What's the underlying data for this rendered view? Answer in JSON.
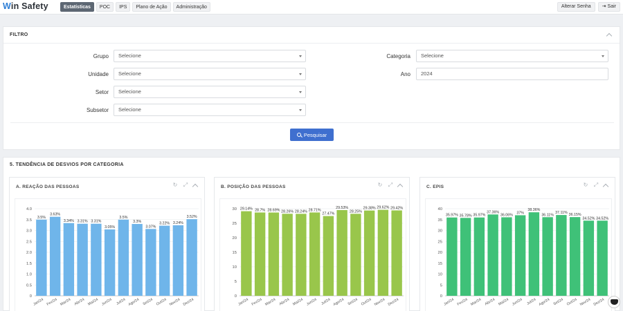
{
  "brand": {
    "name": "Win Safety",
    "mark": "W"
  },
  "nav": [
    "Estatísticas",
    "POC",
    "IPS",
    "Plano de Ação",
    "Administração"
  ],
  "top_right": {
    "change_password": "Alterar Senha",
    "logout": "Sair"
  },
  "filter": {
    "title": "FILTRO",
    "fields": {
      "grupo": {
        "label": "Grupo",
        "value": "Selecione"
      },
      "unidade": {
        "label": "Unidade",
        "value": "Selecione"
      },
      "setor": {
        "label": "Setor",
        "value": "Selecione"
      },
      "subsetor": {
        "label": "Subsetor",
        "value": "Selecione"
      },
      "categoria": {
        "label": "Categoria",
        "value": "Selecione"
      },
      "ano": {
        "label": "Ano",
        "value": "2024"
      }
    },
    "search_button": "Pesquisar"
  },
  "section": {
    "title": "5. TENDÊNCIA DE DESVIOS POR CATEGORIA"
  },
  "chart_data": [
    {
      "type": "bar",
      "title": "A. REAÇÃO DAS PESSOAS",
      "color": "#6fb5ea",
      "categories": [
        "Jan/24",
        "Fev/24",
        "Mar/24",
        "Abr/24",
        "Mai/24",
        "Jun/24",
        "Jul/24",
        "Ago/24",
        "Set/24",
        "Out/24",
        "Nov/24",
        "Dez/24"
      ],
      "values": [
        3.5,
        3.63,
        3.34,
        3.31,
        3.31,
        3.05,
        3.5,
        3.3,
        3.07,
        3.22,
        3.24,
        3.52
      ],
      "labels": [
        "3.5%",
        "3.63%",
        "3.34%",
        "3.31%",
        "3.31%",
        "3.05%",
        "3.5%",
        "3.3%",
        "3.07%",
        "3.22%",
        "3.24%",
        "3.52%"
      ],
      "yticks": [
        "0",
        "0.5",
        "1.0",
        "1.5",
        "2.0",
        "2.5",
        "3.0",
        "3.5",
        "4.0"
      ],
      "ylim": [
        0,
        4.0
      ]
    },
    {
      "type": "bar",
      "title": "B. POSIÇÃO DAS PESSOAS",
      "color": "#99c64b",
      "categories": [
        "Jan/24",
        "Fev/24",
        "Mar/24",
        "Abr/24",
        "Mai/24",
        "Jun/24",
        "Jul/24",
        "Ago/24",
        "Set/24",
        "Out/24",
        "Nov/24",
        "Dez/24"
      ],
      "values": [
        29.14,
        28.7,
        28.69,
        28.26,
        28.24,
        28.71,
        27.47,
        29.53,
        28.25,
        29.38,
        29.62,
        29.42
      ],
      "labels": [
        "29.14%",
        "28.7%",
        "28.69%",
        "28.26%",
        "28.24%",
        "28.71%",
        "27.47%",
        "29.53%",
        "28.25%",
        "29.38%",
        "29.62%",
        "29.42%"
      ],
      "yticks": [
        "0",
        "5",
        "10",
        "15",
        "20",
        "25",
        "30"
      ],
      "ylim": [
        0,
        30
      ]
    },
    {
      "type": "bar",
      "title": "C. EPIS",
      "color": "#3fc178",
      "categories": [
        "Jan/24",
        "Fev/24",
        "Mar/24",
        "Abr/24",
        "Mai/24",
        "Jun/24",
        "Jul/24",
        "Ago/24",
        "Set/24",
        "Out/24",
        "Nov/24",
        "Dez/24"
      ],
      "values": [
        35.97,
        35.78,
        35.97,
        37.36,
        36.06,
        37,
        38.36,
        36.11,
        37.11,
        36.15,
        34.52,
        34.52
      ],
      "labels": [
        "35.97%",
        "35.78%",
        "35.97%",
        "37.36%",
        "36.06%",
        "37%",
        "38.36%",
        "36.11%",
        "37.11%",
        "36.15%",
        "34.52%",
        "34.52%"
      ],
      "yticks": [
        "0",
        "5",
        "10",
        "15",
        "20",
        "25",
        "30",
        "35",
        "40"
      ],
      "ylim": [
        0,
        40
      ]
    }
  ]
}
